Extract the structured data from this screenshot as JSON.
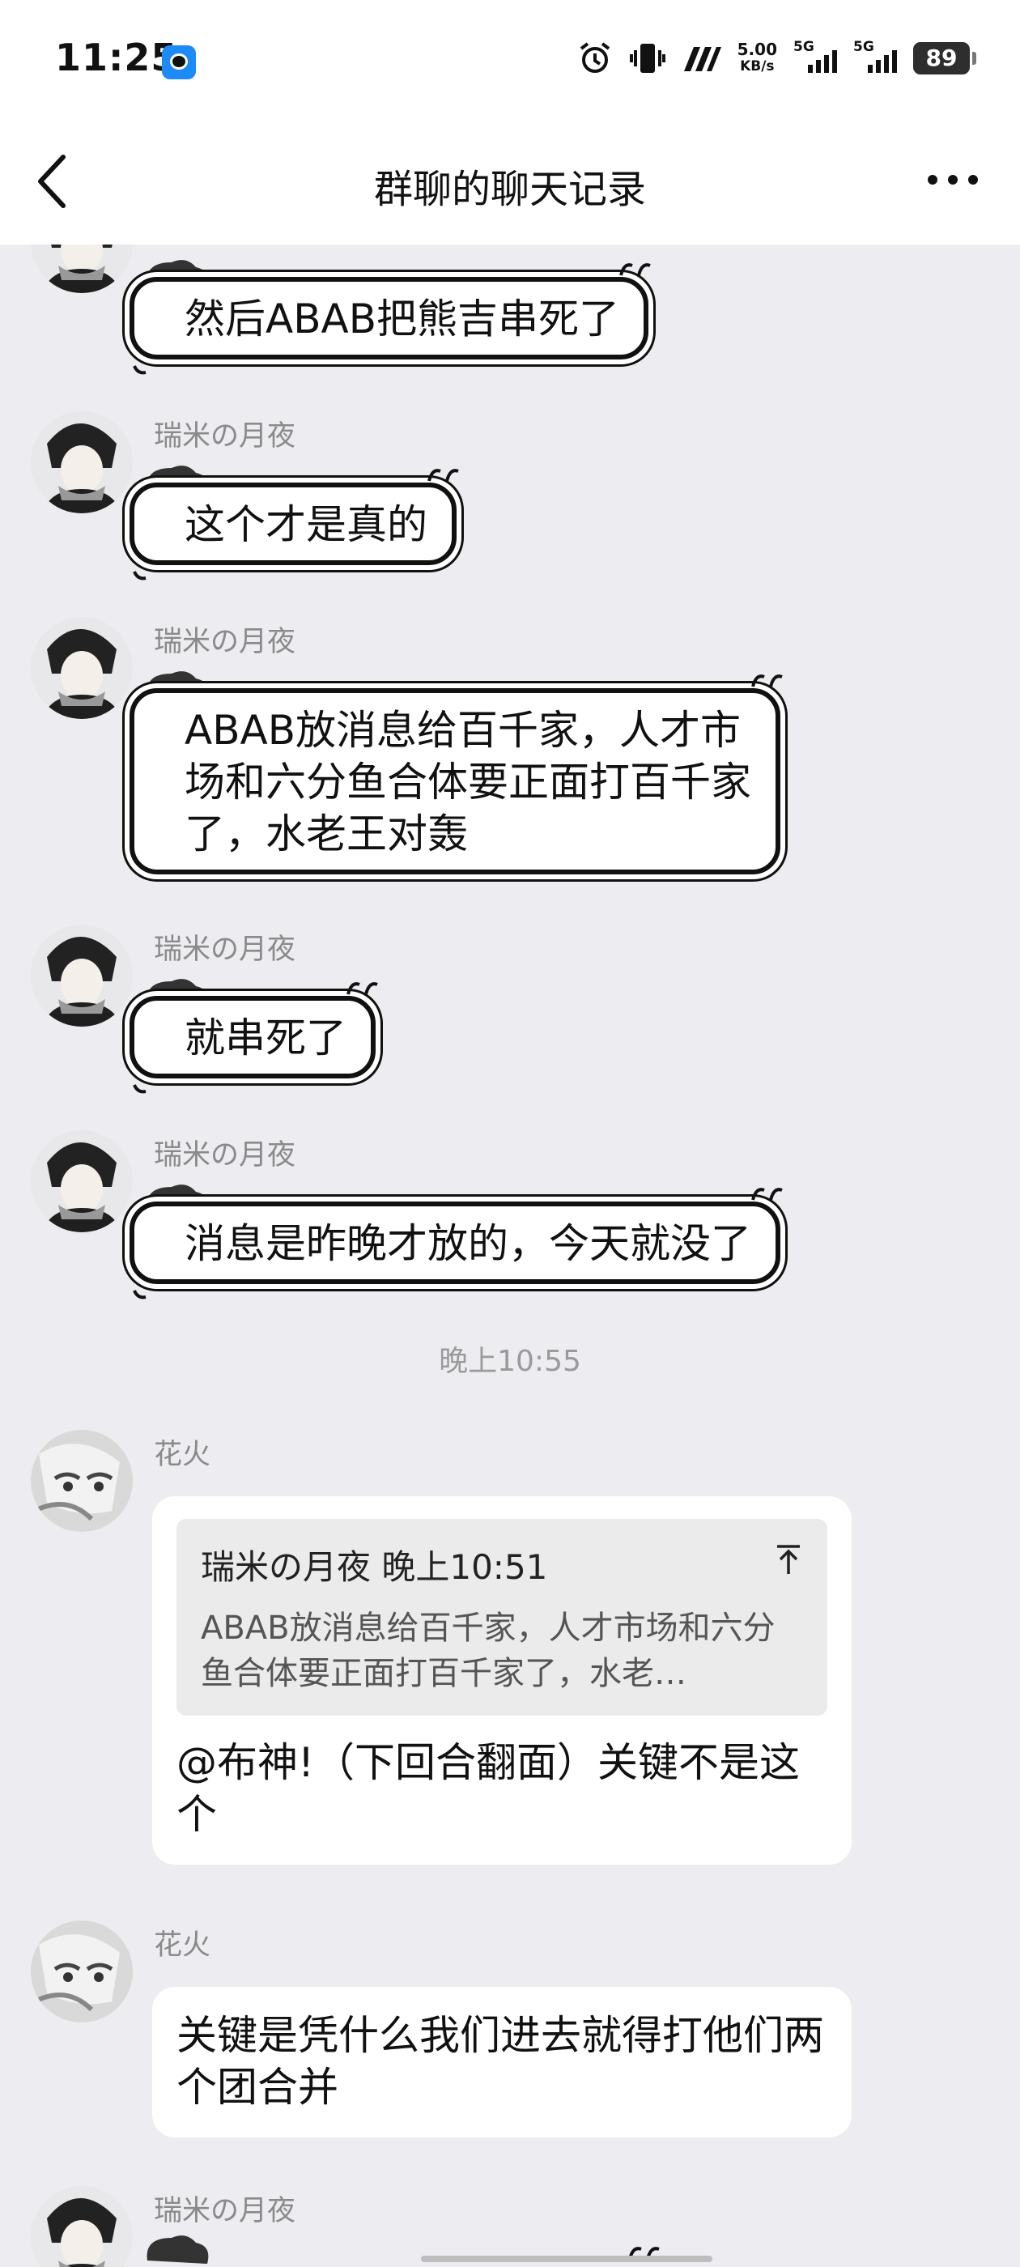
{
  "status": {
    "time": "11:25",
    "speed_value": "5.00",
    "speed_unit": "KB/s",
    "net1": "5G",
    "net2": "5G",
    "battery": "89"
  },
  "header": {
    "title": "群聊的聊天记录",
    "back_icon": "chevron-left-icon",
    "more_icon": "more-horizontal-icon"
  },
  "messages": [
    {
      "sender": "",
      "text": "然后ABAB把熊吉串死了"
    },
    {
      "sender": "瑞米の月夜",
      "text": "这个才是真的"
    },
    {
      "sender": "瑞米の月夜",
      "text": "ABAB放消息给百千家，人才市\n场和六分鱼合体要正面打百千家\n了，水老王对轰"
    },
    {
      "sender": "瑞米の月夜",
      "text": "就串死了"
    },
    {
      "sender": "瑞米の月夜",
      "text": "消息是昨晚才放的，今天就没了"
    }
  ],
  "timestamp": "晚上10:55",
  "huohuo1": {
    "sender": "花火",
    "quote_header": "瑞米の月夜 晚上10:51",
    "quote_text": "ABAB放消息给百千家，人才市场和六分鱼合体要正面打百千家了，水老…",
    "text": "@布神!（下回合翻面）关键不是这个"
  },
  "huohuo2": {
    "sender": "花火",
    "text": "关键是凭什么我们进去就得打他们两个团合并"
  },
  "last": {
    "sender": "瑞米の月夜"
  }
}
